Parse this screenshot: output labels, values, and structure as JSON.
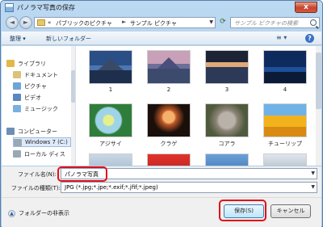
{
  "window": {
    "title": "パノラマ写真の保存",
    "close_label": "x"
  },
  "address_bar": {
    "back_label": "◄",
    "forward_label": "►",
    "path_prefix": "«",
    "crumbs": [
      "パブリックのピクチャ",
      "サンプル ピクチャ"
    ],
    "separator": "►",
    "dropdown_label": "▼",
    "refresh_label": "⟳"
  },
  "search": {
    "placeholder": "サンプル ピクチャの検索"
  },
  "toolbar": {
    "organize_label": "整理 ▾",
    "new_folder_label": "新しいフォルダー",
    "view_label": "≡ ▾",
    "help_label": "?"
  },
  "nav_pane": {
    "items": [
      {
        "label": "ライブラリ",
        "icon": "library-icon",
        "color": "#e3b84b"
      },
      {
        "label": "ドキュメント",
        "icon": "documents-icon",
        "color": "#d9c27a"
      },
      {
        "label": "ピクチャ",
        "icon": "pictures-icon",
        "color": "#6fa4d8"
      },
      {
        "label": "ビデオ",
        "icon": "videos-icon",
        "color": "#5b86bf"
      },
      {
        "label": "ミュージック",
        "icon": "music-icon",
        "color": "#7bb0e0"
      },
      {
        "label": "コンピューター",
        "icon": "computer-icon",
        "color": "#6d8fb5"
      },
      {
        "label": "Windows 7 (C:)",
        "icon": "drive-icon",
        "color": "#9aa7b5"
      },
      {
        "label": "ローカル ディス",
        "icon": "drive-icon",
        "color": "#9aa7b5"
      }
    ]
  },
  "files": [
    {
      "label": "1"
    },
    {
      "label": "2"
    },
    {
      "label": "3"
    },
    {
      "label": "4"
    },
    {
      "label": "アジサイ"
    },
    {
      "label": "クラゲ"
    },
    {
      "label": "コアラ"
    },
    {
      "label": "チューリップ"
    },
    {
      "label": ""
    },
    {
      "label": ""
    },
    {
      "label": ""
    },
    {
      "label": ""
    }
  ],
  "filename": {
    "label": "ファイル名(N):",
    "value": "パノラマ写真",
    "dropdown_label": "▼"
  },
  "filetype": {
    "label": "ファイルの種類(T):",
    "value": "JPG (*.jpg;*.jpe;*.exif;*.jfif;*.jpeg)",
    "dropdown_label": "▼"
  },
  "footer": {
    "hide_folders_label": "フォルダーの非表示",
    "hide_folders_chevron": "▲",
    "save_label": "保存(S)",
    "cancel_label": "キャンセル"
  },
  "colors": {
    "highlight": "#e0101a",
    "accent": "#3c7fb1"
  }
}
